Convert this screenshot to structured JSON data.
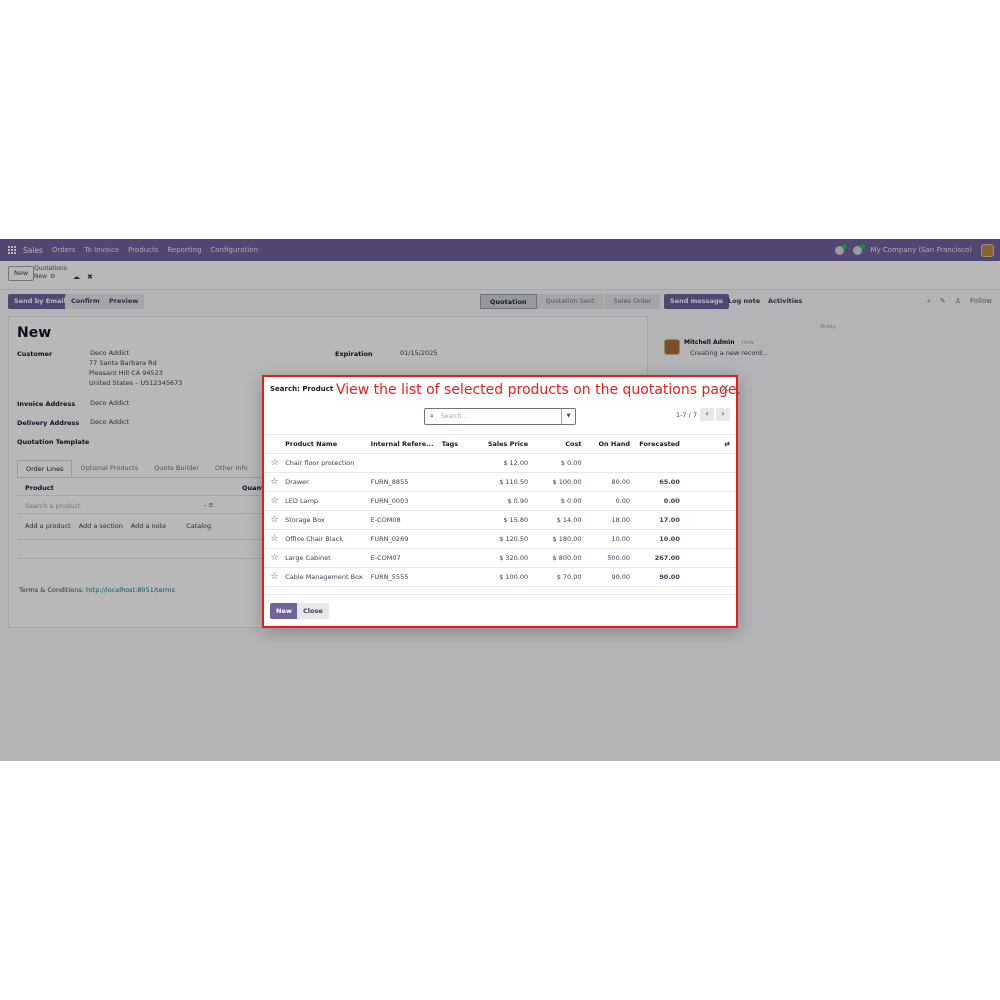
{
  "navbar": {
    "app_name": "Sales",
    "menu": [
      "Orders",
      "To Invoice",
      "Products",
      "Reporting",
      "Configuration"
    ],
    "company": "My Company (San Francisco)"
  },
  "control_panel": {
    "new_label": "New",
    "breadcrumb_parent": "Quotations",
    "breadcrumb_current": "New"
  },
  "form_header": {
    "send_by_email": "Send by Email",
    "confirm": "Confirm",
    "preview": "Preview",
    "statuses": [
      "Quotation",
      "Quotation Sent",
      "Sales Order"
    ],
    "active_status": "Quotation"
  },
  "form": {
    "title": "New",
    "customer_label": "Customer",
    "customer_name": "Deco Addict",
    "customer_address": [
      "77 Santa Barbara Rd",
      "Pleasant Hill CA 94523",
      "United States – US12345673"
    ],
    "expiration_label": "Expiration",
    "expiration_value": "01/15/2025",
    "invoice_address_label": "Invoice Address",
    "invoice_address_value": "Deco Addict",
    "delivery_address_label": "Delivery Address",
    "delivery_address_value": "Deco Addict",
    "quotation_template_label": "Quotation Template",
    "tabs": [
      "Order Lines",
      "Optional Products",
      "Quote Builder",
      "Other Info"
    ],
    "product_col": "Product",
    "quantity_col": "Quant",
    "product_placeholder": "Search a product",
    "add_links": [
      "Add a product",
      "Add a section",
      "Add a note",
      "Catalog"
    ],
    "terms_label": "Terms & Conditions:",
    "terms_link": "http://localhost:8051/terms"
  },
  "chatter": {
    "send_message": "Send message",
    "log_note": "Log note",
    "activities": "Activities",
    "follow": "Follow",
    "today": "Today",
    "author": "Mitchell Admin",
    "author_time": "- now",
    "message": "Creating a new record..."
  },
  "modal": {
    "title": "Search: Product",
    "annotation": "View the list of selected products on the quotations page.",
    "search_placeholder": "Search...",
    "pager": "1-7 / 7",
    "columns": [
      "Product Name",
      "Internal Refere...",
      "Tags",
      "Sales Price",
      "Cost",
      "On Hand",
      "Forecasted"
    ],
    "rows": [
      {
        "name": "Chair floor protection",
        "ref": "",
        "tags": "",
        "price": "$ 12.00",
        "cost": "$ 0.00",
        "on_hand": "",
        "forecasted": ""
      },
      {
        "name": "Drawer",
        "ref": "FURN_8855",
        "tags": "",
        "price": "$ 110.50",
        "cost": "$ 100.00",
        "on_hand": "80.00",
        "forecasted": "65.00"
      },
      {
        "name": "LED Lamp",
        "ref": "FURN_0003",
        "tags": "",
        "price": "$ 0.90",
        "cost": "$ 0.00",
        "on_hand": "0.00",
        "forecasted": "0.00"
      },
      {
        "name": "Storage Box",
        "ref": "E-COM08",
        "tags": "",
        "price": "$ 15.80",
        "cost": "$ 14.00",
        "on_hand": "18.00",
        "forecasted": "17.00"
      },
      {
        "name": "Office Chair Black",
        "ref": "FURN_0269",
        "tags": "",
        "price": "$ 120.50",
        "cost": "$ 180.00",
        "on_hand": "10.00",
        "forecasted": "10.00"
      },
      {
        "name": "Large Cabinet",
        "ref": "E-COM07",
        "tags": "",
        "price": "$ 320.00",
        "cost": "$ 800.00",
        "on_hand": "500.00",
        "forecasted": "267.00"
      },
      {
        "name": "Cable Management Box",
        "ref": "FURN_5555",
        "tags": "",
        "price": "$ 100.00",
        "cost": "$ 70.00",
        "on_hand": "90.00",
        "forecasted": "90.00"
      }
    ],
    "new_button": "New",
    "close_button": "Close"
  },
  "colors": {
    "brand": "#71639e",
    "annotation": "#e11d1d",
    "link": "#017e84"
  }
}
